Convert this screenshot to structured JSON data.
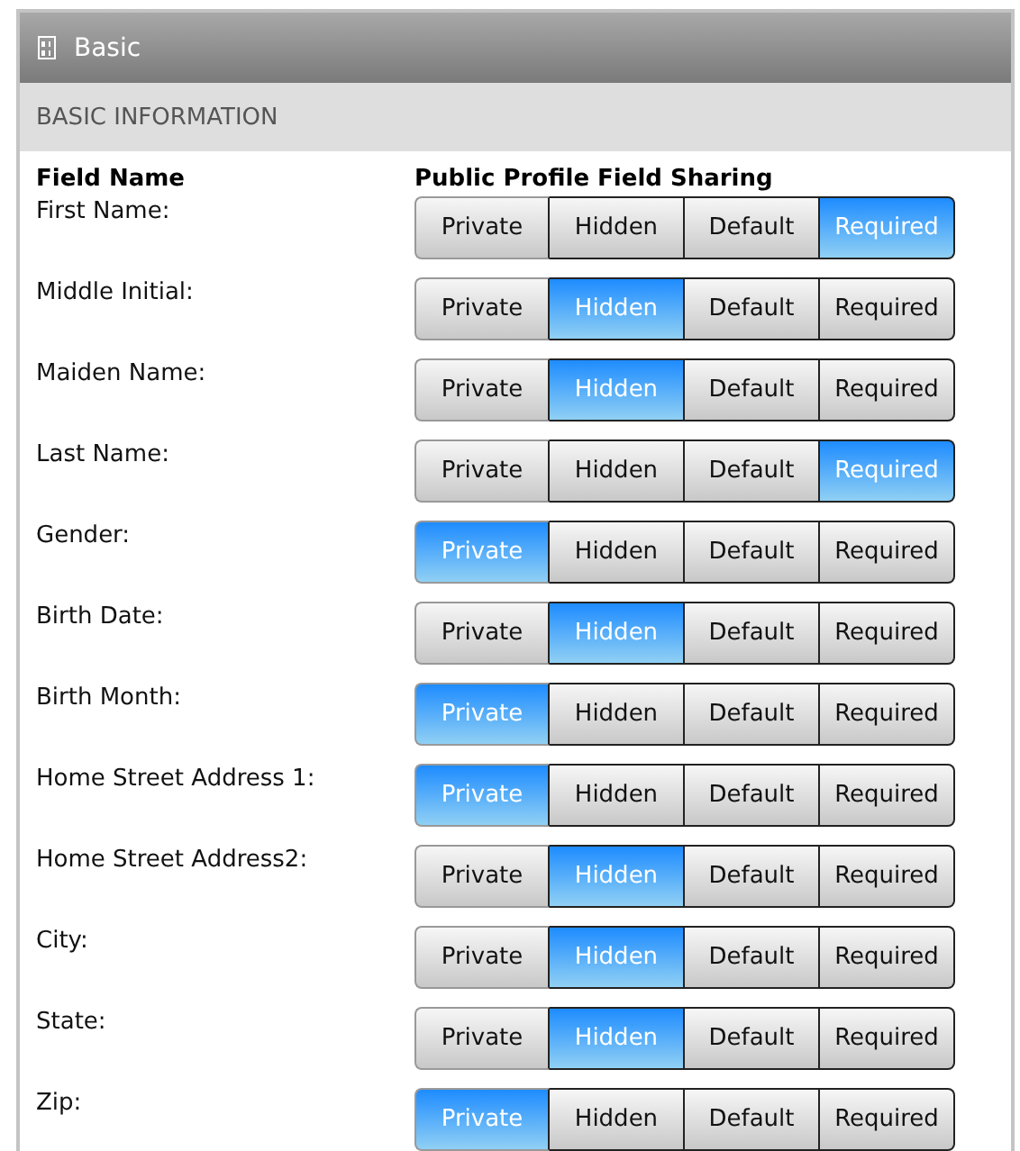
{
  "panel": {
    "title": "Basic"
  },
  "section": {
    "title": "BASIC INFORMATION"
  },
  "columns": [
    "Field Name",
    "Public Profile Field Sharing"
  ],
  "rows": [
    {
      "label": "First Name:",
      "options": [
        {
          "label": "Private",
          "selected": false
        },
        {
          "label": "Hidden",
          "selected": false
        },
        {
          "label": "Default",
          "selected": false
        },
        {
          "label": "Required",
          "selected": true
        }
      ]
    },
    {
      "label": "Middle Initial:",
      "options": [
        {
          "label": "Private",
          "selected": false
        },
        {
          "label": "Hidden",
          "selected": true
        },
        {
          "label": "Default",
          "selected": false
        },
        {
          "label": "Required",
          "selected": false
        }
      ]
    },
    {
      "label": "Maiden Name:",
      "options": [
        {
          "label": "Private",
          "selected": false
        },
        {
          "label": "Hidden",
          "selected": true
        },
        {
          "label": "Default",
          "selected": false
        },
        {
          "label": "Required",
          "selected": false
        }
      ]
    },
    {
      "label": "Last Name:",
      "options": [
        {
          "label": "Private",
          "selected": false
        },
        {
          "label": "Hidden",
          "selected": false
        },
        {
          "label": "Default",
          "selected": false
        },
        {
          "label": "Required",
          "selected": true
        }
      ]
    },
    {
      "label": "Gender:",
      "options": [
        {
          "label": "Private",
          "selected": true
        },
        {
          "label": "Hidden",
          "selected": false
        },
        {
          "label": "Default",
          "selected": false
        },
        {
          "label": "Required",
          "selected": false
        }
      ]
    },
    {
      "label": "Birth Date:",
      "options": [
        {
          "label": "Private",
          "selected": false
        },
        {
          "label": "Hidden",
          "selected": true
        },
        {
          "label": "Default",
          "selected": false
        },
        {
          "label": "Required",
          "selected": false
        }
      ]
    },
    {
      "label": "Birth Month:",
      "options": [
        {
          "label": "Private",
          "selected": true
        },
        {
          "label": "Hidden",
          "selected": false
        },
        {
          "label": "Default",
          "selected": false
        },
        {
          "label": "Required",
          "selected": false
        }
      ]
    },
    {
      "label": "Home Street Address 1:",
      "options": [
        {
          "label": "Private",
          "selected": true
        },
        {
          "label": "Hidden",
          "selected": false
        },
        {
          "label": "Default",
          "selected": false
        },
        {
          "label": "Required",
          "selected": false
        }
      ]
    },
    {
      "label": "Home Street Address2:",
      "options": [
        {
          "label": "Private",
          "selected": false
        },
        {
          "label": "Hidden",
          "selected": true
        },
        {
          "label": "Default",
          "selected": false
        },
        {
          "label": "Required",
          "selected": false
        }
      ]
    },
    {
      "label": "City:",
      "options": [
        {
          "label": "Private",
          "selected": false
        },
        {
          "label": "Hidden",
          "selected": true
        },
        {
          "label": "Default",
          "selected": false
        },
        {
          "label": "Required",
          "selected": false
        }
      ]
    },
    {
      "label": "State:",
      "options": [
        {
          "label": "Private",
          "selected": false
        },
        {
          "label": "Hidden",
          "selected": true
        },
        {
          "label": "Default",
          "selected": false
        },
        {
          "label": "Required",
          "selected": false
        }
      ]
    },
    {
      "label": "Zip:",
      "options": [
        {
          "label": "Private",
          "selected": true
        },
        {
          "label": "Hidden",
          "selected": false
        },
        {
          "label": "Default",
          "selected": false
        },
        {
          "label": "Required",
          "selected": false
        }
      ]
    }
  ]
}
